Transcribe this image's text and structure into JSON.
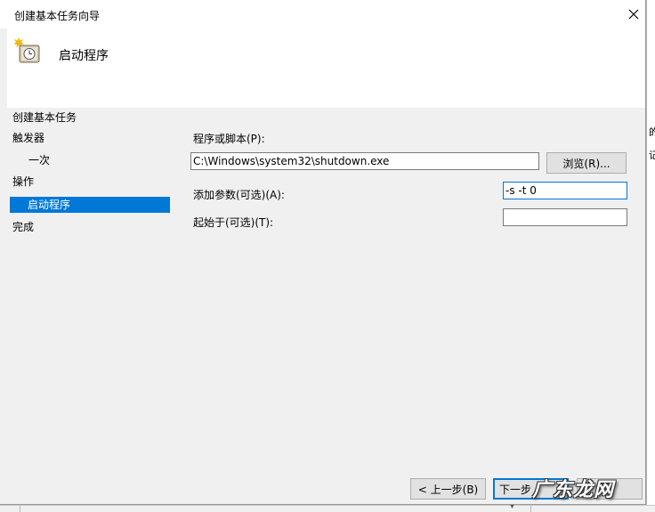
{
  "window": {
    "title": "创建基本任务向导",
    "close_glyph": "✕"
  },
  "header": {
    "title": "启动程序",
    "icon": "clock-icon"
  },
  "sidebar": {
    "title": "创建基本任务",
    "items": [
      {
        "label": "触发器",
        "indent": false,
        "selected": false
      },
      {
        "label": "一次",
        "indent": true,
        "selected": false
      },
      {
        "label": "操作",
        "indent": false,
        "selected": false
      },
      {
        "label": "启动程序",
        "indent": true,
        "selected": true
      },
      {
        "label": "完成",
        "indent": false,
        "selected": false
      }
    ]
  },
  "form": {
    "program_label": "程序或脚本(P):",
    "program_value": "C:\\Windows\\system32\\shutdown.exe",
    "browse_label": "浏览(R)...",
    "args_label": "添加参数(可选)(A):",
    "args_value": "-s -t 0",
    "start_in_label": "起始于(可选)(T):",
    "start_in_value": ""
  },
  "footer": {
    "back_label": "< 上一步(B)",
    "next_label": "下一步"
  },
  "background_fragments": {
    "frag1": "的",
    "frag2": "记"
  },
  "watermark": "广东龙网",
  "colors": {
    "selection": "#0078d7",
    "dialog_bg": "#f0f0f0",
    "header_bg": "#ffffff"
  }
}
